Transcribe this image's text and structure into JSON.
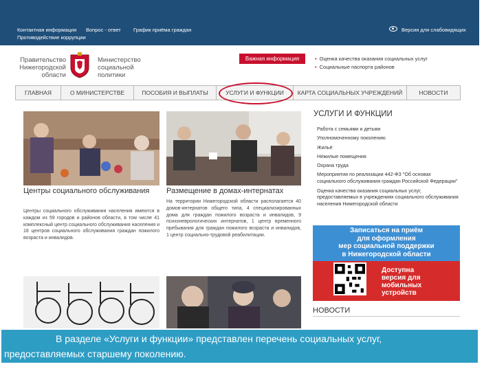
{
  "top_links": {
    "contacts": "Контактная информация",
    "question": "Вопрос - ответ",
    "schedule": "График приёма граждан",
    "anticorruption": "Противодействие коррупции",
    "accessible": "Версия для слабовидящих"
  },
  "logo": {
    "left": [
      "Правительство",
      "Нижегородской",
      "области"
    ],
    "right": [
      "Министерство",
      "социальной",
      "политики"
    ]
  },
  "important_label": "Важная информация",
  "side_links": [
    "Оценка качества оказания социальных услуг",
    "Социальные паспорта районов"
  ],
  "nav": [
    {
      "label": "ГЛАВНАЯ"
    },
    {
      "label": "О МИНИСТЕРСТВЕ"
    },
    {
      "label": "ПОСОБИЯ И ВЫПЛАТЫ"
    },
    {
      "label": "УСЛУГИ И ФУНКЦИИ"
    },
    {
      "label": "КАРТА СОЦИАЛЬНЫХ УЧРЕЖДЕНИЙ"
    },
    {
      "label": "НОВОСТИ"
    }
  ],
  "cards": [
    {
      "title": "Центры социального обслуживания",
      "text": "Центры социального обслуживания населения имеются в каждом из 59 городов и районов области, в том числе 41 комплексный центр социального обслуживания населения и 18 центров социального обслуживания граждан пожилого возраста и инвалидов."
    },
    {
      "title": "Размещение в домах-интернатах",
      "text": "На территории Нижегородской области располагается 40 домов-интернатов общего типа, 4 специализированных дома для граждан пожилого возраста и инвалидов, 9 психоневрологических интернатов, 1 центр временного пребывания для граждан пожилого возраста и инвалидов, 1 центр социально-трудовой реабилитации."
    }
  ],
  "services": {
    "title": "УСЛУГИ И ФУНКЦИИ",
    "items": [
      "Работа с семьями и детьми",
      "Уполномоченному поколению",
      "Жильё",
      "Нежилые помещения",
      "Охрана труда",
      "Мероприятия по реализации 442-ФЗ \"Об основах социального обслуживания граждан Российской Федерации\"",
      "Оценка качества оказания социальных услуг, предоставляемых в учреждениях социального обслуживания населения Нижегородской области"
    ]
  },
  "banner": {
    "header": [
      "Записаться на приём",
      "для оформления",
      "мер социальной поддержки",
      "в Нижегородской области"
    ],
    "mobile": [
      "Доступна",
      "версия для",
      "мобильных",
      "устройств"
    ]
  },
  "news_title": "НОВОСТИ",
  "caption": {
    "line1": "В разделе «Услуги и функции» представлен перечень социальных услуг,",
    "line2": "предоставляемых старшему поколению."
  }
}
